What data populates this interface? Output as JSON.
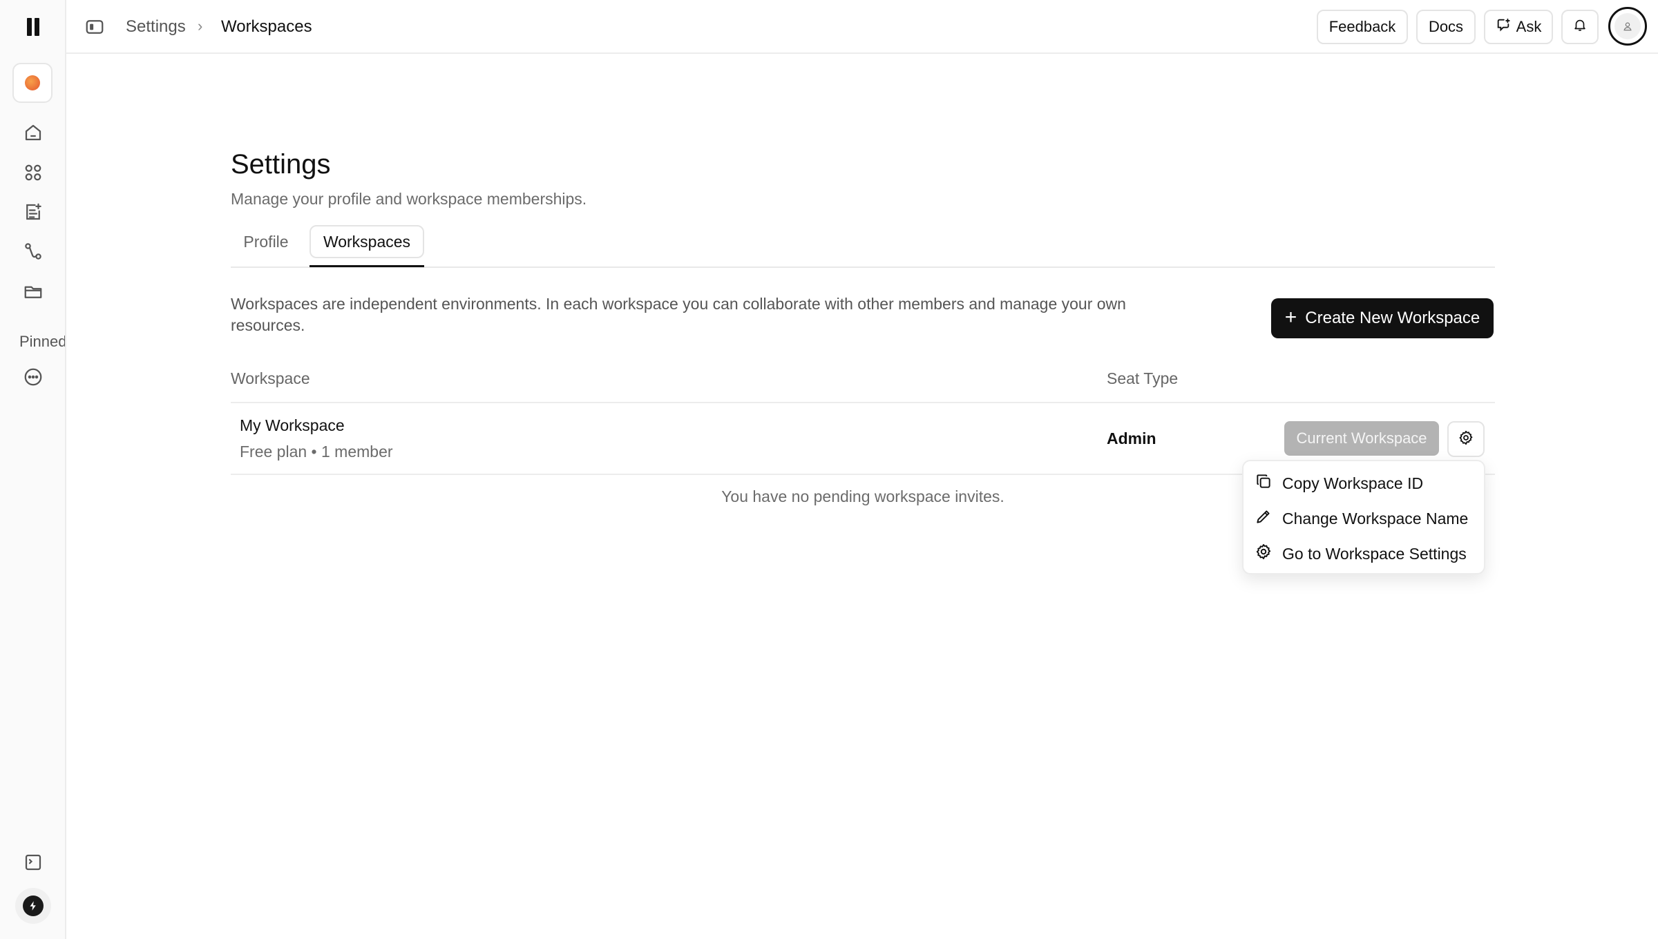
{
  "sidebar": {
    "pinned_label": "Pinned",
    "icons": [
      "home-icon",
      "apps-icon",
      "notes-icon",
      "workflow-icon",
      "folder-icon",
      "more-icon",
      "terminal-icon",
      "bolt-icon"
    ]
  },
  "topbar": {
    "breadcrumb": [
      "Settings",
      "Workspaces"
    ],
    "separator": "›",
    "feedback": "Feedback",
    "docs": "Docs",
    "ask": "Ask"
  },
  "main": {
    "title": "Settings",
    "subtitle": "Manage your profile and workspace memberships.",
    "tabs": [
      {
        "label": "Profile",
        "active": false
      },
      {
        "label": "Workspaces",
        "active": true
      }
    ],
    "description": "Workspaces are independent environments. In each workspace you can collaborate with other members and manage your own resources.",
    "create_button": "Create New Workspace",
    "create_plus": "+",
    "table": {
      "headers": {
        "workspace": "Workspace",
        "seat_type": "Seat Type"
      },
      "rows": [
        {
          "name": "My Workspace",
          "meta": "Free plan • 1 member",
          "seat": "Admin",
          "status_button": "Current Workspace"
        }
      ]
    },
    "no_invites": "You have no pending workspace invites."
  },
  "menu": {
    "items": [
      {
        "label": "Copy Workspace ID",
        "icon": "copy-icon"
      },
      {
        "label": "Change Workspace Name",
        "icon": "pencil-icon"
      },
      {
        "label": "Go to Workspace Settings",
        "icon": "gear-icon"
      }
    ]
  },
  "colors": {
    "accent": "#111111",
    "muted_text": "#6b6b6b",
    "disabled_button": "#b3b3b3",
    "border": "#ececec"
  }
}
